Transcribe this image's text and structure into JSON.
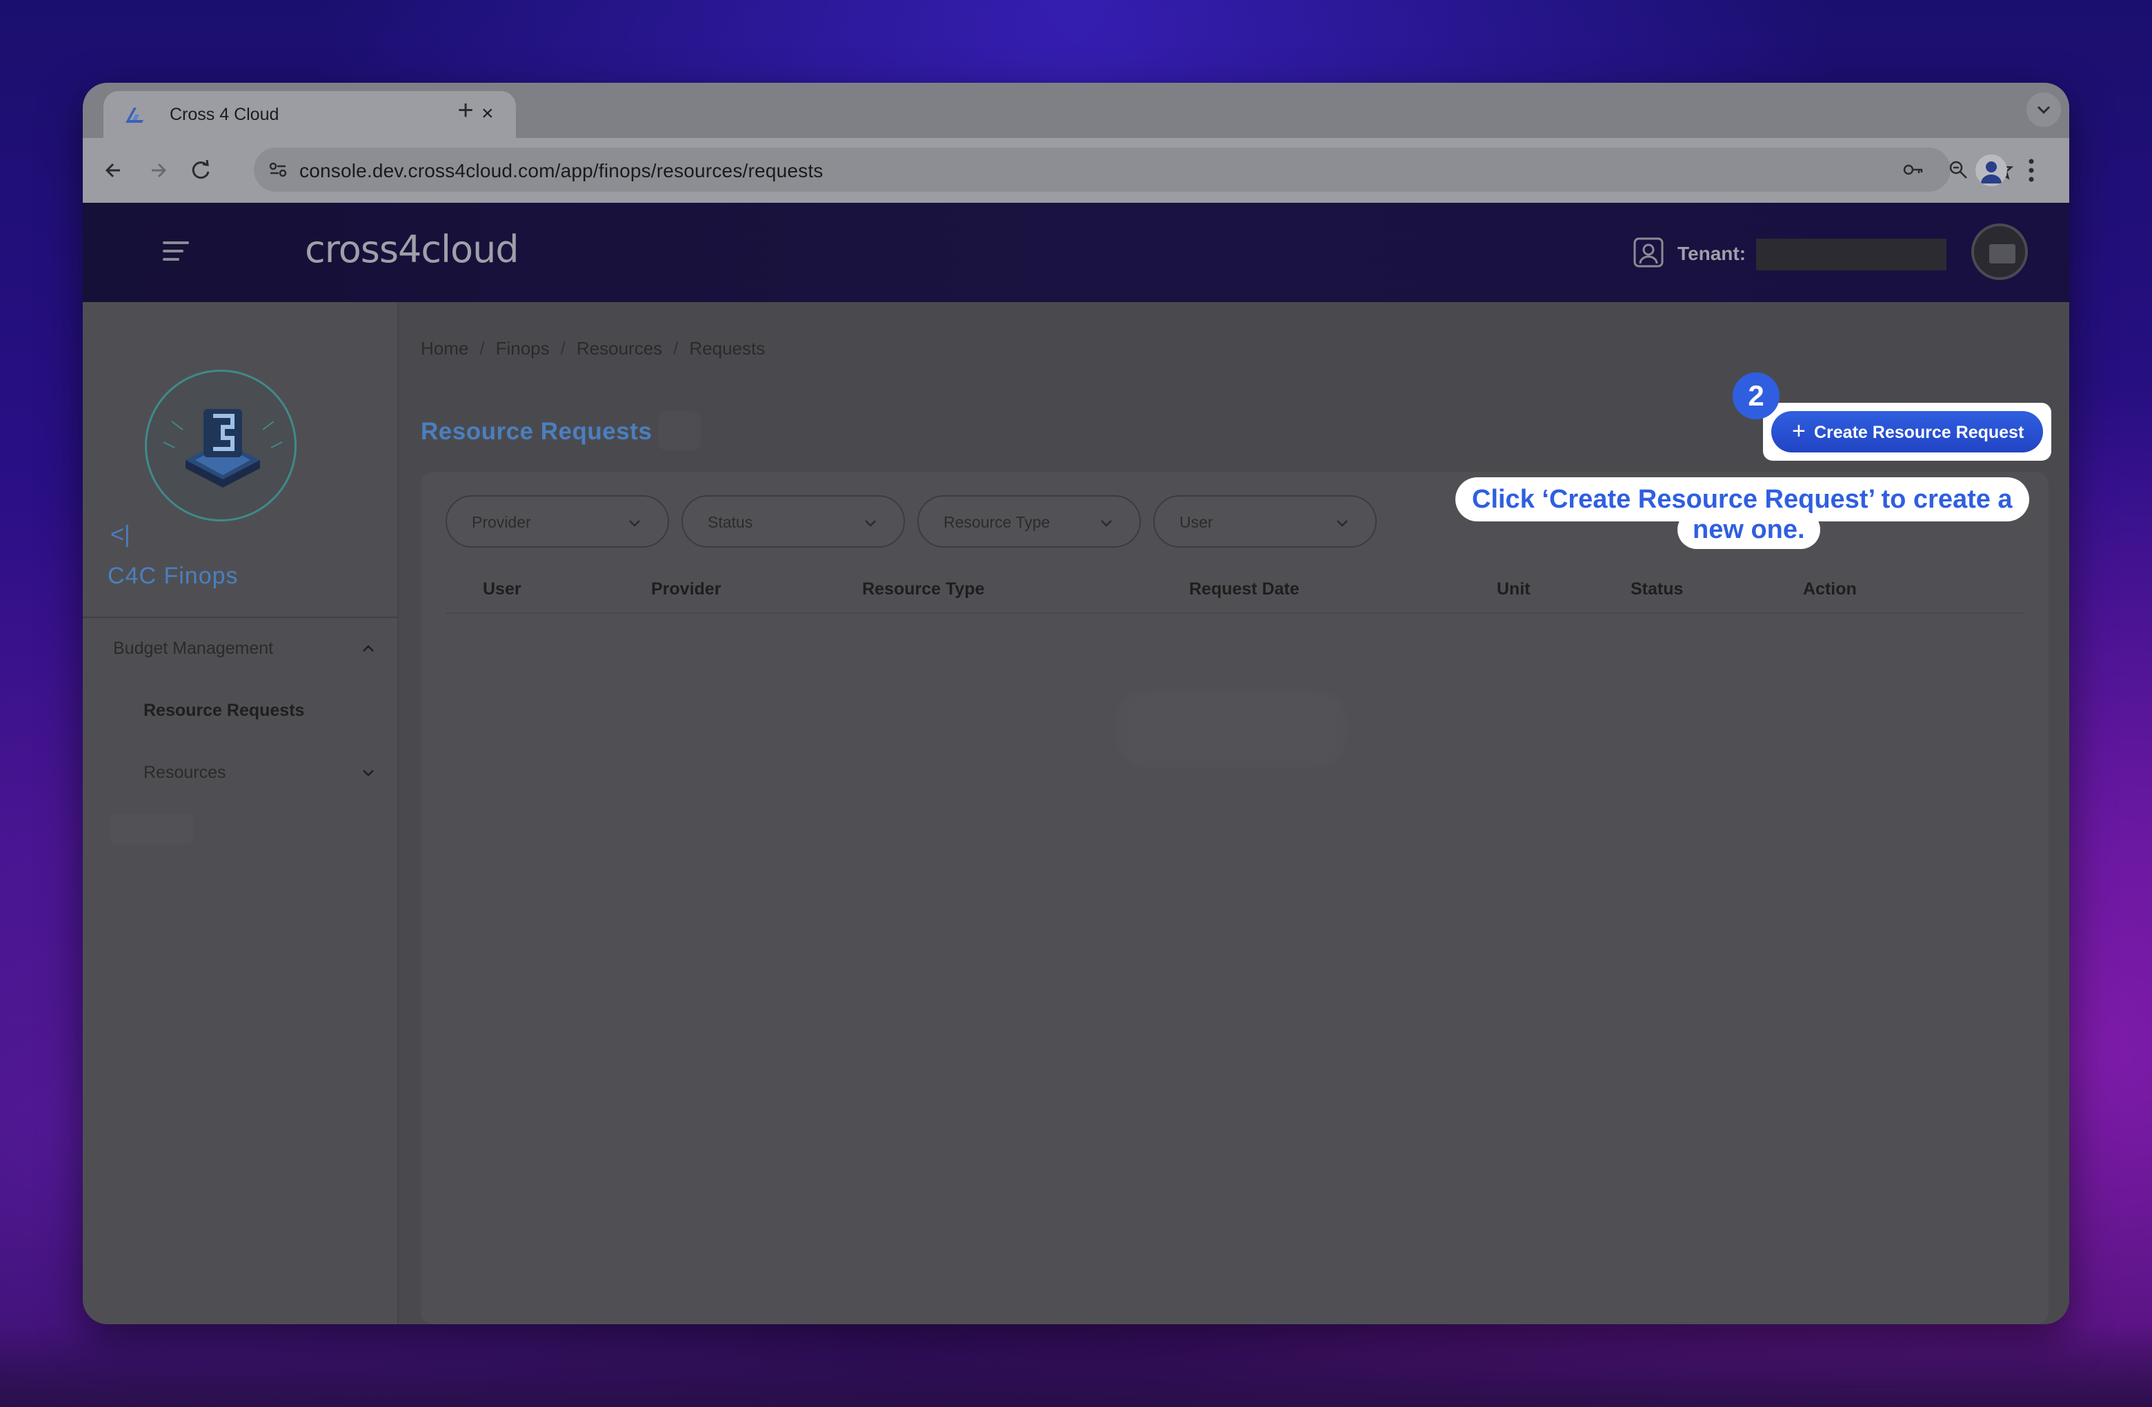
{
  "browser": {
    "tab_title": "Cross 4 Cloud",
    "url": "console.dev.cross4cloud.com/app/finops/resources/requests",
    "new_tab_symbol": "+",
    "close_symbol": "×"
  },
  "header": {
    "logo_text": "cross4cloud",
    "tenant_label": "Tenant:"
  },
  "sidebar": {
    "collapse_symbol": "<|",
    "title": "C4C Finops",
    "group": {
      "label": "Budget Management",
      "expanded": true
    },
    "items": [
      {
        "label": "Resource Requests",
        "active": true
      },
      {
        "label": "Resources",
        "expandable": true
      }
    ]
  },
  "breadcrumb": [
    "Home",
    "Finops",
    "Resources",
    "Requests"
  ],
  "breadcrumb_separator": "/",
  "page": {
    "title": "Resource Requests",
    "create_button": "Create Resource Request",
    "create_icon": "+"
  },
  "filters": [
    {
      "label": "Provider"
    },
    {
      "label": "Status"
    },
    {
      "label": "Resource Type"
    },
    {
      "label": "User"
    }
  ],
  "table": {
    "columns": [
      "User",
      "Provider",
      "Resource Type",
      "Request Date",
      "Unit",
      "Status",
      "Action"
    ],
    "rows": []
  },
  "guide": {
    "step": "2",
    "tooltip_line1": "Click ‘Create Resource Request’ to create a",
    "tooltip_line2": "new one."
  },
  "colors": {
    "accent": "#2f5fe0",
    "title_blue": "#4b7fbf"
  }
}
